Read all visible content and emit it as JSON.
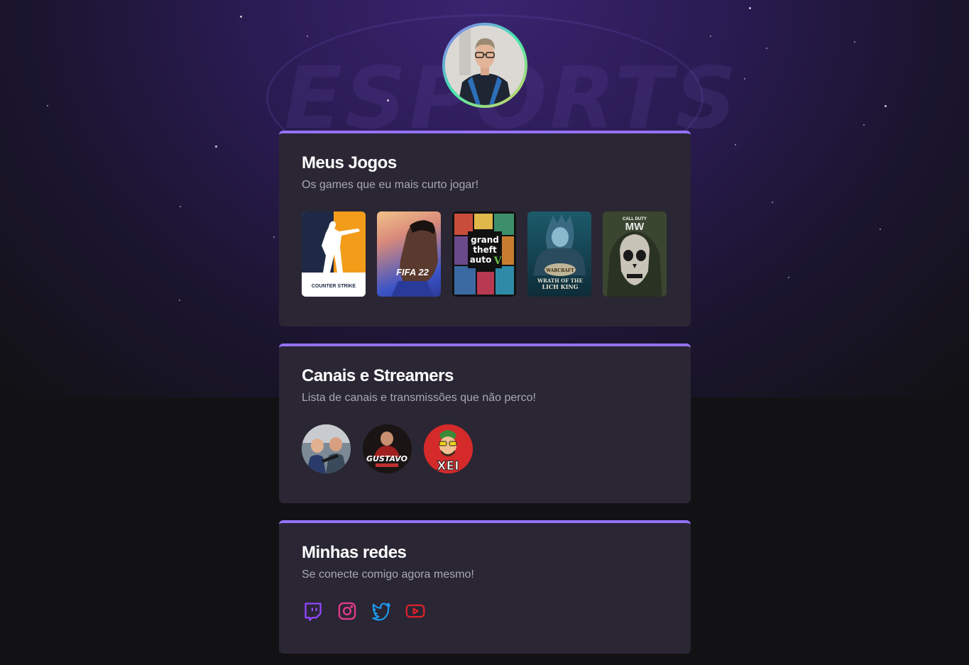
{
  "profile": {
    "avatar_icon": "profile-photo-icon"
  },
  "background": {
    "logo_text": "ESPORTS"
  },
  "games_card": {
    "title": "Meus Jogos",
    "subtitle": "Os games que eu mais curto jogar!",
    "games": [
      {
        "name": "cs-go-cover",
        "label": "COUNTER STRIKE",
        "color": "#f39c1a"
      },
      {
        "name": "fifa-22-cover",
        "label": "FIFA 22",
        "color": "#3d55c7"
      },
      {
        "name": "gta-v-cover",
        "label": "grand theft auto V",
        "color": "#1a1a1a"
      },
      {
        "name": "wow-wotlk-cover",
        "label": "WRATH OF THE LICH KING",
        "color": "#1a4a5c"
      },
      {
        "name": "cod-mw2-cover",
        "label": "CALL DUTY MW",
        "color": "#3a4a2a"
      }
    ]
  },
  "streamers_card": {
    "title": "Canais e Streamers",
    "subtitle": "Lista de canais e transmissões que não perco!",
    "streamers": [
      {
        "name": "streamer-1-avatar",
        "label": ""
      },
      {
        "name": "streamer-2-avatar",
        "label": "GUSTAVO"
      },
      {
        "name": "streamer-3-avatar",
        "label": "XEI"
      }
    ]
  },
  "social_card": {
    "title": "Minhas redes",
    "subtitle": "Se conecte comigo agora mesmo!",
    "links": [
      {
        "icon": "twitch-icon",
        "color": "#9146ff"
      },
      {
        "icon": "instagram-icon",
        "color": "#e1306c"
      },
      {
        "icon": "twitter-icon",
        "color": "#1d9bf0"
      },
      {
        "icon": "youtube-icon",
        "color": "#ff0000"
      }
    ]
  }
}
